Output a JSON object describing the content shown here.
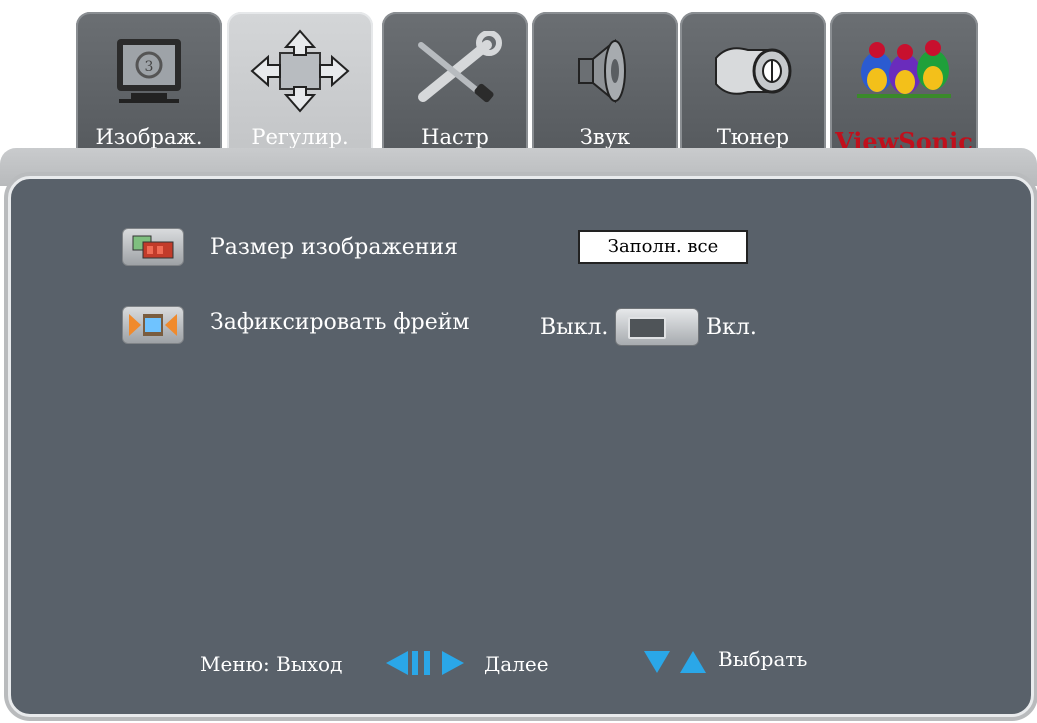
{
  "tabs": [
    {
      "label": "Изображ.",
      "icon": "tv-monitor-icon",
      "active": false
    },
    {
      "label": "Регулир.",
      "icon": "adjust-arrows-icon",
      "active": true
    },
    {
      "label": "Настр",
      "icon": "tools-wrench-screwdriver-icon",
      "active": false
    },
    {
      "label": "Звук",
      "icon": "speaker-icon",
      "active": false
    },
    {
      "label": "Тюнер",
      "icon": "tuner-connector-icon",
      "active": false
    },
    {
      "label": "ViewSonic",
      "icon": "viewsonic-birds-logo",
      "active": false
    }
  ],
  "settings": {
    "image_size": {
      "label": "Размер изображения",
      "value": "Заполн. все",
      "icon": "picture-size-icon"
    },
    "freeze_frame": {
      "label": "Зафиксировать фрейм",
      "off_label": "Выкл.",
      "on_label": "Вкл.",
      "icon": "freeze-frame-icon",
      "state": "off"
    }
  },
  "footer": {
    "menu_exit": "Меню: Выход",
    "next": "Далее",
    "select": "Выбрать",
    "arrows_lr": "left-right-arrows-icon",
    "arrows_ud": "up-down-arrows-icon"
  },
  "colors": {
    "panel": "#59616a",
    "tab": "#5f6367",
    "tab_active": "#c8cacc",
    "accent_blue": "#2aa7e8",
    "brand_red": "#c0101c"
  }
}
